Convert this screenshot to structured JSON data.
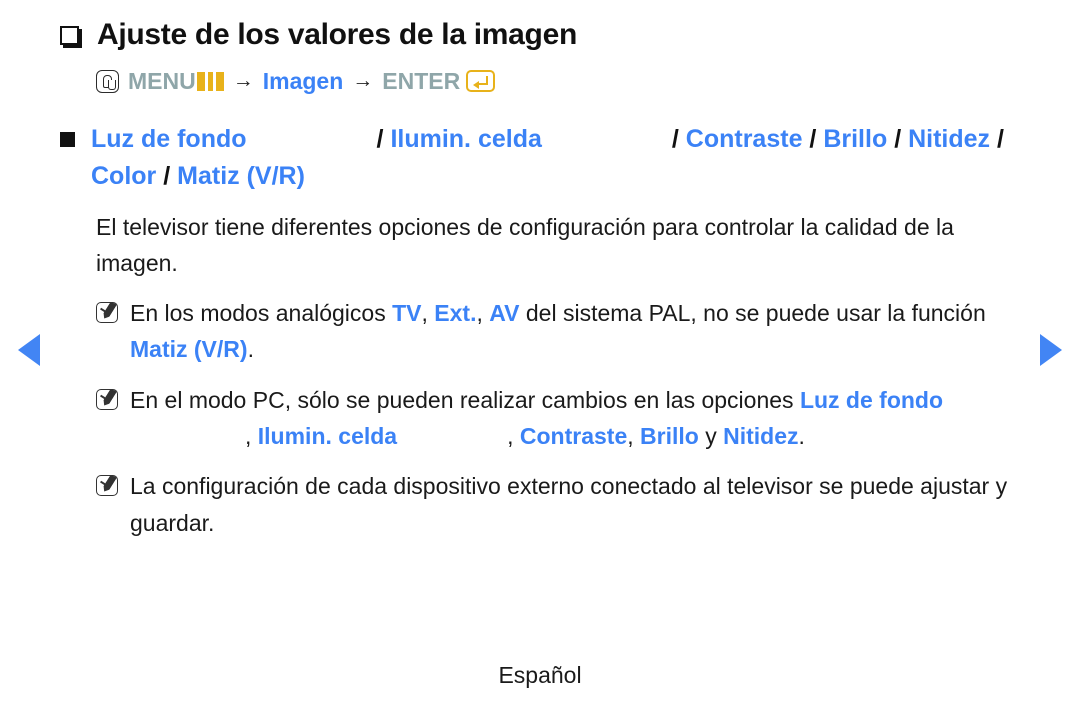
{
  "nav": {
    "prev_icon": "triangle-left-icon",
    "next_icon": "triangle-right-icon",
    "arrow_color": "#4285f4"
  },
  "title": {
    "bullet_icon": "hollow-square-bullet-icon",
    "text": "Ajuste de los valores de la imagen"
  },
  "menu_path": {
    "hand_icon": "hand-pointer-icon",
    "menu_label": "MENU",
    "bars_icon": "menu-bars-icon",
    "arrow1": "→",
    "section_label": "Imagen",
    "arrow2": "→",
    "enter_label": "ENTER",
    "enter_icon": "enter-key-icon",
    "gray_color": "#8fa6a9",
    "blue_color": "#3b82f6",
    "gold_color": "#e8b21a"
  },
  "options": {
    "bullet_icon": "filled-square-bullet-icon",
    "items": [
      {
        "label": "Luz de fondo",
        "separator": ""
      },
      {
        "label": "Ilumin. celda",
        "separator": "/"
      },
      {
        "label": "Contraste",
        "separator": "/"
      },
      {
        "label": "Brillo",
        "separator": "/"
      },
      {
        "label": "Nitidez",
        "separator": "/"
      },
      {
        "label": "Color",
        "separator": "/"
      },
      {
        "label": "Matiz (V/R)",
        "separator": "/"
      }
    ],
    "sep1": "/",
    "sep2": "/",
    "sep3": "/",
    "sep4": "/",
    "sep5": "/",
    "sep6": "/",
    "term_backlight": "Luz de fondo",
    "term_cell_light": "Ilumin. celda",
    "term_contrast": "Contraste",
    "term_brightness": "Brillo",
    "term_sharpness": "Nitidez",
    "term_color": "Color",
    "term_tint": "Matiz (V/R)"
  },
  "paragraph": {
    "text": "El televisor tiene diferentes opciones de configuración para controlar la calidad de la imagen."
  },
  "notes": [
    {
      "icon": "note-pencil-icon",
      "part1": "En los modos analógicos ",
      "term1": "TV",
      "mid1": ", ",
      "term2": "Ext.",
      "mid2": ", ",
      "term3": "AV",
      "part2": " del sistema PAL, no se puede usar la función ",
      "term4": "Matiz (V/R)",
      "part3": "."
    },
    {
      "icon": "note-pencil-icon",
      "part1": "En el modo PC, sólo se pueden realizar cambios en las opciones ",
      "term1": "Luz de fondo",
      "mid1": ", ",
      "term2": "Ilumin. celda",
      "mid2": ", ",
      "term3": "Contraste",
      "mid3": ", ",
      "term4": "Brillo",
      "mid4": " y ",
      "term5": "Nitidez",
      "part2": "."
    },
    {
      "icon": "note-pencil-icon",
      "text": "La configuración de cada dispositivo externo conectado al televisor se puede ajustar y guardar."
    }
  ],
  "footer": {
    "language": "Español"
  }
}
